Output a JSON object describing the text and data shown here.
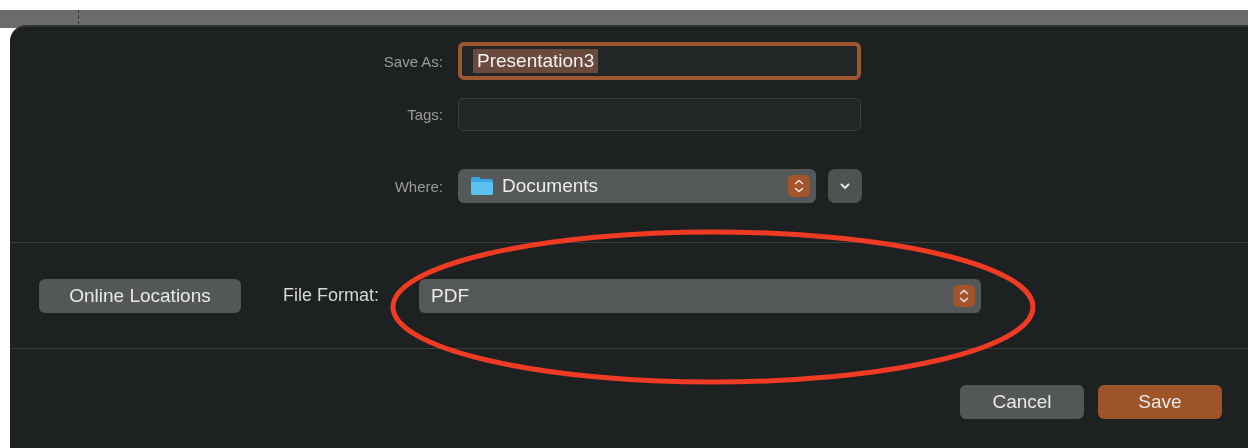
{
  "dialog": {
    "save_as": {
      "label": "Save As:",
      "value": "Presentation3",
      "focused": true
    },
    "tags": {
      "label": "Tags:"
    },
    "where": {
      "label": "Where:",
      "value": "Documents"
    },
    "online_locations_button": "Online Locations",
    "file_format": {
      "label": "File Format:",
      "value": "PDF"
    },
    "buttons": [
      {
        "label": "Cancel",
        "kind": "secondary"
      },
      {
        "label": "Save",
        "kind": "primary"
      }
    ]
  },
  "annotation": {
    "kind": "ellipse"
  }
}
